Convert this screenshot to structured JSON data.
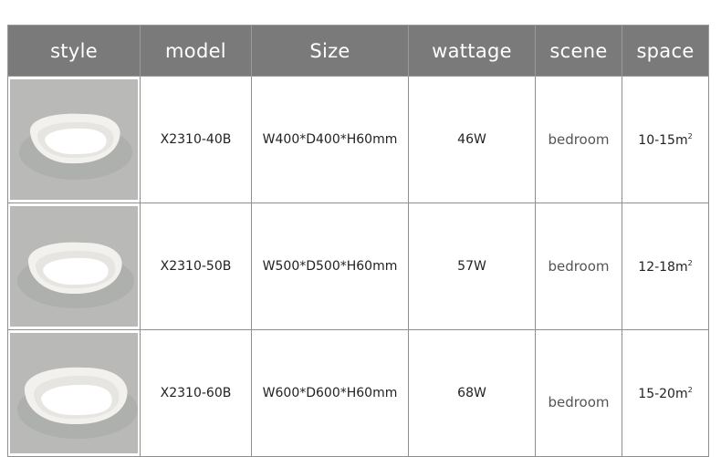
{
  "headers": {
    "style": "style",
    "model": "model",
    "size": "Size",
    "wattage": "wattage",
    "scene": "scene",
    "space": "space"
  },
  "rows": [
    {
      "model": "X2310-40B",
      "size": "W400*D400*H60mm",
      "wattage": "46W",
      "scene": "bedroom",
      "space": "10-15m",
      "space_unit_sup": "2"
    },
    {
      "model": "X2310-50B",
      "size": "W500*D500*H60mm",
      "wattage": "57W",
      "scene": "bedroom",
      "space": "12-18m",
      "space_unit_sup": "2"
    },
    {
      "model": "X2310-60B",
      "size": "W600*D600*H60mm",
      "wattage": "68W",
      "scene": "bedroom",
      "space": "15-20m",
      "space_unit_sup": "2"
    }
  ],
  "colors": {
    "header_bg": "#7a7a7a",
    "header_text": "#ffffff",
    "photo_bg": "#b9bab8"
  },
  "icons": {
    "lamp_photo": "ceiling-lamp-photo"
  }
}
